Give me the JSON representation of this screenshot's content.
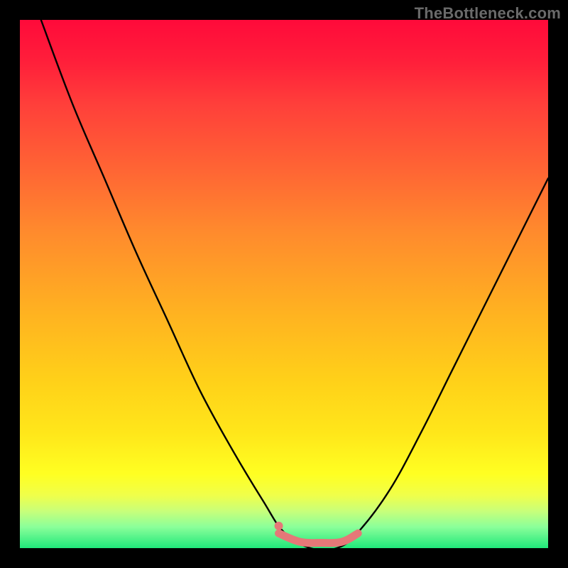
{
  "watermark": {
    "text": "TheBottleneck.com"
  },
  "chart_data": {
    "type": "line",
    "title": "",
    "xlabel": "",
    "ylabel": "",
    "xlim": [
      0,
      100
    ],
    "ylim": [
      0,
      100
    ],
    "grid": false,
    "legend": false,
    "background_gradient": [
      "#ff0a3a",
      "#ffff22",
      "#20e87a"
    ],
    "series": [
      {
        "name": "bottleneck-curve",
        "color": "#000000",
        "x": [
          4,
          10,
          16,
          22,
          28,
          34,
          40,
          46,
          50,
          55,
          60,
          64,
          70,
          76,
          82,
          88,
          94,
          100
        ],
        "values": [
          100,
          84,
          70,
          56,
          43,
          30,
          19,
          9,
          3,
          0,
          0,
          3,
          11,
          22,
          34,
          46,
          58,
          70
        ]
      }
    ],
    "markers": [
      {
        "name": "tolerant-segment",
        "color": "#e57878",
        "shape": "thick-line",
        "x": [
          49,
          53,
          57,
          61,
          64
        ],
        "y": [
          2.8,
          1.2,
          1.0,
          1.2,
          2.8
        ]
      },
      {
        "name": "tolerant-dot-left",
        "color": "#e57878",
        "shape": "dot",
        "x": 49,
        "y": 4.2
      }
    ]
  }
}
